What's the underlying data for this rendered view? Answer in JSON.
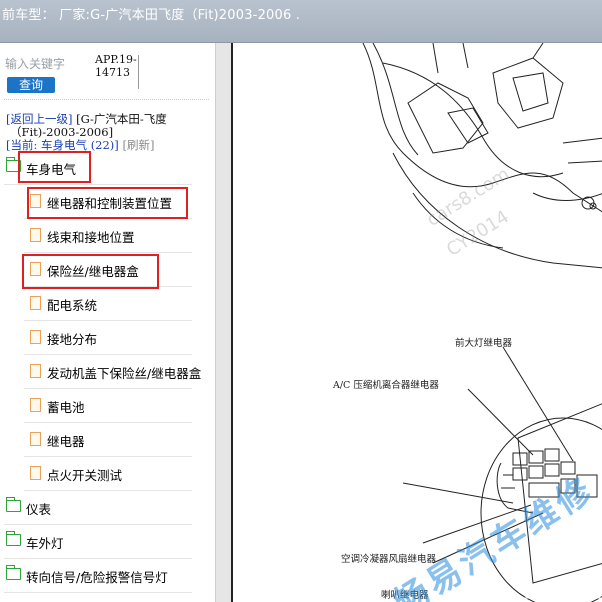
{
  "titlebar": {
    "text": "前车型： 厂家:G-广汽本田飞度（Fit)2003-2006 ."
  },
  "search": {
    "placeholder": "输入关键字",
    "button": "查询",
    "app_line1": "APP.19-",
    "app_line2": "14713"
  },
  "breadcrumb": {
    "back": "[返回上一级]",
    "path_line1": "[G-广汽本田-飞度",
    "path_line2": "（Fit)-2003-2006]",
    "current_prefix": "[当前: ",
    "current_name": "车身电气",
    "current_count": "(22)",
    "current_suffix": "]",
    "refresh": "[刷新]"
  },
  "tree": [
    {
      "type": "folder",
      "label": "车身电气"
    },
    {
      "type": "doc",
      "label": "继电器和控制装置位置"
    },
    {
      "type": "doc",
      "label": "线束和接地位置"
    },
    {
      "type": "doc",
      "label": "保险丝/继电器盒"
    },
    {
      "type": "doc",
      "label": "配电系统"
    },
    {
      "type": "doc",
      "label": "接地分布"
    },
    {
      "type": "doc",
      "label": "发动机盖下保险丝/继电器盒"
    },
    {
      "type": "doc",
      "label": "蓄电池"
    },
    {
      "type": "doc",
      "label": "继电器"
    },
    {
      "type": "doc",
      "label": "点火开关测试"
    },
    {
      "type": "folder",
      "label": "仪表"
    },
    {
      "type": "folder",
      "label": "车外灯"
    },
    {
      "type": "folder",
      "label": "转向信号/危险报警信号灯"
    }
  ],
  "diagram": {
    "label_1": "前大灯继电器",
    "label_2": "A/C 压缩机离合器继电器",
    "label_3": "空调冷凝器风扇继电器",
    "label_4": "喇叭继电器"
  },
  "watermark": {
    "main": "畅易汽车维修",
    "faint1": "cars8.com",
    "faint2": "CY2014"
  },
  "colors": {
    "search_button": "#1b74c5",
    "highlight": "#e02020",
    "link": "#1a3fb4"
  }
}
